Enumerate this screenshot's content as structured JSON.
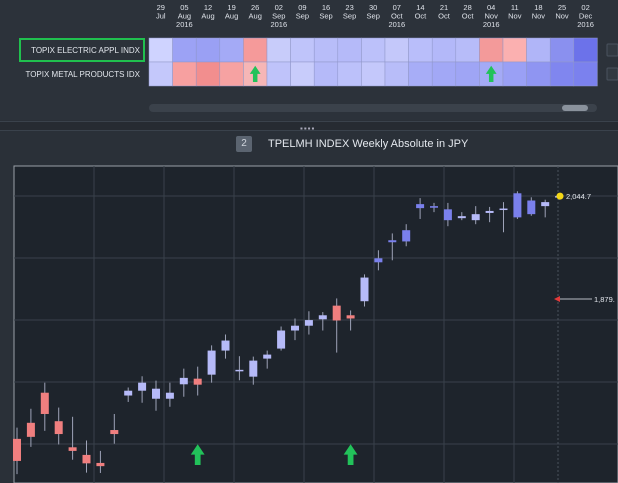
{
  "heatmap": {
    "columns": [
      {
        "d": "29",
        "m": "Jul",
        "y": ""
      },
      {
        "d": "05",
        "m": "Aug",
        "y": "2016"
      },
      {
        "d": "12",
        "m": "Aug",
        "y": ""
      },
      {
        "d": "19",
        "m": "Aug",
        "y": ""
      },
      {
        "d": "26",
        "m": "Aug",
        "y": ""
      },
      {
        "d": "02",
        "m": "Sep",
        "y": "2016"
      },
      {
        "d": "09",
        "m": "Sep",
        "y": ""
      },
      {
        "d": "16",
        "m": "Sep",
        "y": ""
      },
      {
        "d": "23",
        "m": "Sep",
        "y": ""
      },
      {
        "d": "30",
        "m": "Sep",
        "y": ""
      },
      {
        "d": "07",
        "m": "Oct",
        "y": "2016"
      },
      {
        "d": "14",
        "m": "Oct",
        "y": ""
      },
      {
        "d": "21",
        "m": "Oct",
        "y": ""
      },
      {
        "d": "28",
        "m": "Oct",
        "y": ""
      },
      {
        "d": "04",
        "m": "Nov",
        "y": "2016"
      },
      {
        "d": "11",
        "m": "Nov",
        "y": ""
      },
      {
        "d": "18",
        "m": "Nov",
        "y": ""
      },
      {
        "d": "25",
        "m": "Nov",
        "y": ""
      },
      {
        "d": "02",
        "m": "Dec",
        "y": "2016"
      }
    ],
    "rows": [
      {
        "label": "TOPIX ELECTRIC APPL INDX",
        "selected": true,
        "colors": [
          "#cfd3ff",
          "#9ca2f5",
          "#9aa0f4",
          "#a4aaf6",
          "#f59a9a",
          "#c8ccfa",
          "#bfc4fa",
          "#b8bdf9",
          "#b5baf9",
          "#bcc1fa",
          "#c4c8fa",
          "#b9befa",
          "#b3b8f9",
          "#b7bcf9",
          "#f39a9a",
          "#fbb0b0",
          "#b0b5f8",
          "#8a90ef",
          "#6c72ea"
        ],
        "arrow_cols": []
      },
      {
        "label": "TOPIX METAL PRODUCTS IDX",
        "selected": false,
        "colors": [
          "#c4c8fb",
          "#f7a0a0",
          "#f28e8e",
          "#f6a2a2",
          "#f6b6b6",
          "#bfc3fa",
          "#c8ccfb",
          "#b5baf9",
          "#bcc1fa",
          "#c4c8fb",
          "#b8bdf9",
          "#a7adf7",
          "#a2a8f6",
          "#9fa5f5",
          "#a4aaf6",
          "#9aa0f5",
          "#8f95f2",
          "#8086ef",
          "#7b81ee"
        ],
        "arrow_cols": [
          4,
          14
        ]
      }
    ]
  },
  "chart_title": {
    "badge": "2",
    "text": "TPELMH INDEX Weekly Absolute  in JPY"
  },
  "chart_data": {
    "type": "candlestick",
    "series": [
      {
        "o": 1440,
        "h": 1468,
        "l": 1352,
        "c": 1385,
        "col": "#f07f7f"
      },
      {
        "o": 1480,
        "h": 1515,
        "l": 1420,
        "c": 1445,
        "col": "#f07f7f"
      },
      {
        "o": 1555,
        "h": 1580,
        "l": 1460,
        "c": 1502,
        "col": "#f07f7f"
      },
      {
        "o": 1484,
        "h": 1518,
        "l": 1426,
        "c": 1452,
        "col": "#f07f7f"
      },
      {
        "o": 1410,
        "h": 1495,
        "l": 1388,
        "c": 1419,
        "col": "#f07f7f"
      },
      {
        "o": 1400,
        "h": 1436,
        "l": 1356,
        "c": 1379,
        "col": "#f07f7f"
      },
      {
        "o": 1380,
        "h": 1410,
        "l": 1355,
        "c": 1372,
        "col": "#f07f7f"
      },
      {
        "o": 1462,
        "h": 1502,
        "l": 1428,
        "c": 1452,
        "col": "#f07f7f"
      },
      {
        "o": 1548,
        "h": 1568,
        "l": 1532,
        "c": 1560,
        "col": "#b6baf8"
      },
      {
        "o": 1560,
        "h": 1596,
        "l": 1530,
        "c": 1580,
        "col": "#b6baf8"
      },
      {
        "o": 1540,
        "h": 1585,
        "l": 1510,
        "c": 1565,
        "col": "#b6baf8"
      },
      {
        "o": 1540,
        "h": 1580,
        "l": 1520,
        "c": 1555,
        "col": "#b6baf8"
      },
      {
        "o": 1592,
        "h": 1615,
        "l": 1545,
        "c": 1576,
        "col": "#b6baf8"
      },
      {
        "o": 1590,
        "h": 1620,
        "l": 1548,
        "c": 1575,
        "col": "#f07f7f"
      },
      {
        "o": 1600,
        "h": 1673,
        "l": 1580,
        "c": 1660,
        "col": "#b6baf8"
      },
      {
        "o": 1660,
        "h": 1700,
        "l": 1640,
        "c": 1685,
        "col": "#b6baf8"
      },
      {
        "o": 1610,
        "h": 1646,
        "l": 1586,
        "c": 1612,
        "col": "#b6baf8"
      },
      {
        "o": 1595,
        "h": 1645,
        "l": 1575,
        "c": 1635,
        "col": "#b6baf8"
      },
      {
        "o": 1640,
        "h": 1660,
        "l": 1615,
        "c": 1650,
        "col": "#b6baf8"
      },
      {
        "o": 1665,
        "h": 1720,
        "l": 1660,
        "c": 1710,
        "col": "#b6baf8"
      },
      {
        "o": 1710,
        "h": 1740,
        "l": 1686,
        "c": 1722,
        "col": "#b6baf8"
      },
      {
        "o": 1722,
        "h": 1758,
        "l": 1700,
        "c": 1736,
        "col": "#b6baf8"
      },
      {
        "o": 1738,
        "h": 1756,
        "l": 1710,
        "c": 1748,
        "col": "#b6baf8"
      },
      {
        "o": 1772,
        "h": 1790,
        "l": 1655,
        "c": 1735,
        "col": "#f07f7f"
      },
      {
        "o": 1740,
        "h": 1760,
        "l": 1710,
        "c": 1748,
        "col": "#f07f7f"
      },
      {
        "o": 1783,
        "h": 1850,
        "l": 1770,
        "c": 1842,
        "col": "#b6baf8"
      },
      {
        "o": 1880,
        "h": 1910,
        "l": 1860,
        "c": 1890,
        "col": "#7a80ec"
      },
      {
        "o": 1930,
        "h": 1952,
        "l": 1885,
        "c": 1935,
        "col": "#7a80ec"
      },
      {
        "o": 1932,
        "h": 1975,
        "l": 1920,
        "c": 1960,
        "col": "#7a80ec"
      },
      {
        "o": 2025,
        "h": 2040,
        "l": 1988,
        "c": 2015,
        "col": "#7a80ec"
      },
      {
        "o": 2016,
        "h": 2028,
        "l": 2005,
        "c": 2020,
        "col": "#7a80ec"
      },
      {
        "o": 2012,
        "h": 2028,
        "l": 1970,
        "c": 1985,
        "col": "#7a80ec"
      },
      {
        "o": 1995,
        "h": 2005,
        "l": 1985,
        "c": 1990,
        "col": "#b6baf8"
      },
      {
        "o": 2000,
        "h": 2020,
        "l": 1975,
        "c": 1985,
        "col": "#b6baf8"
      },
      {
        "o": 2003,
        "h": 2018,
        "l": 1980,
        "c": 2008,
        "col": "#b6baf8"
      },
      {
        "o": 2014,
        "h": 2030,
        "l": 1955,
        "c": 2012,
        "col": "#b6baf8"
      },
      {
        "o": 1992,
        "h": 2057,
        "l": 1988,
        "c": 2052,
        "col": "#7a80ec"
      },
      {
        "o": 2000,
        "h": 2042,
        "l": 1996,
        "c": 2034,
        "col": "#7a80ec"
      },
      {
        "o": 2030,
        "h": 2036,
        "l": 1992,
        "c": 2020,
        "col": "#b6baf8"
      },
      {
        "o": 2044,
        "h": 2052,
        "l": 2036,
        "c": 2045,
        "col": "#b6baf8"
      }
    ],
    "last_value_label": "2,044.7",
    "ref_value_label": "1,879.",
    "arrow_candles": [
      13,
      24
    ]
  }
}
